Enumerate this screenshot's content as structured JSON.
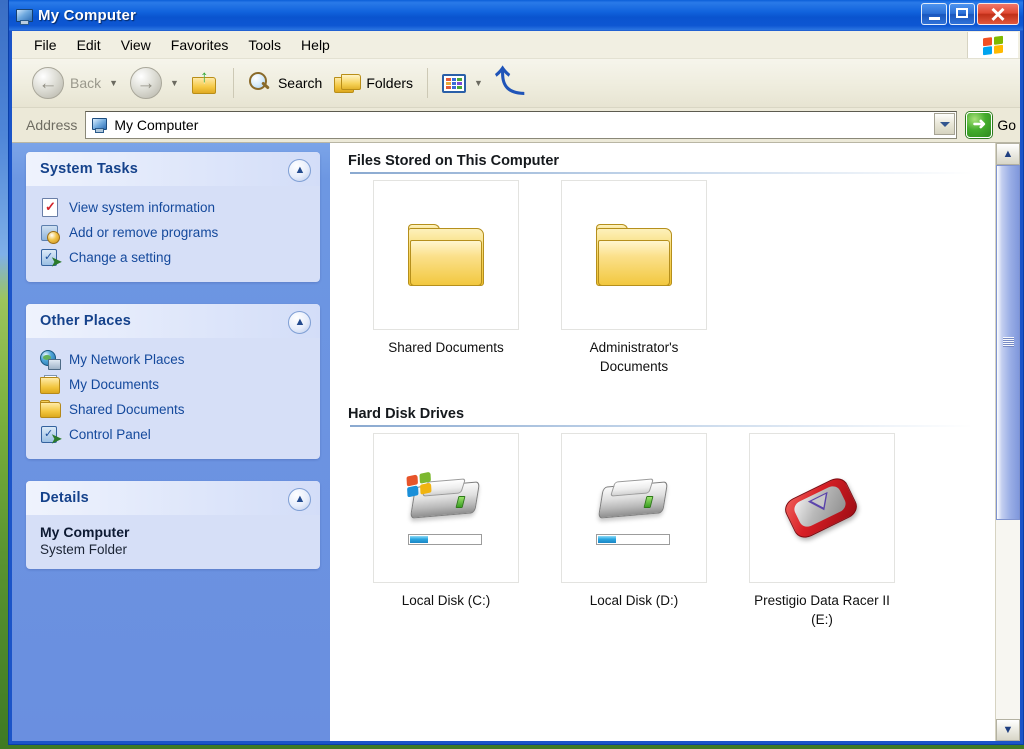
{
  "window": {
    "title": "My Computer",
    "title_icon": "my-computer-icon",
    "controls": {
      "minimize": "minimize-button",
      "maximize": "maximize-button",
      "close": "close-button"
    }
  },
  "menubar": {
    "items": [
      {
        "label": "File"
      },
      {
        "label": "Edit"
      },
      {
        "label": "View"
      },
      {
        "label": "Favorites"
      },
      {
        "label": "Tools"
      },
      {
        "label": "Help"
      }
    ],
    "brand_icon": "windows-flag-icon"
  },
  "toolbar": {
    "back_label": "Back",
    "back_icon": "back-arrow-icon",
    "forward_icon": "forward-arrow-icon",
    "up_icon": "up-folder-icon",
    "search_label": "Search",
    "search_icon": "search-icon",
    "folders_label": "Folders",
    "folders_icon": "folders-icon",
    "views_icon": "views-grid-icon",
    "undo_icon": "undo-arrow-icon"
  },
  "address": {
    "label": "Address",
    "value": "My Computer",
    "icon": "my-computer-icon",
    "dropdown_icon": "chevron-down-icon",
    "go_label": "Go",
    "go_icon": "go-arrow-icon"
  },
  "sidebar": {
    "panels": [
      {
        "title": "System Tasks",
        "collapse_icon": "chevron-up-icon",
        "items": [
          {
            "label": "View system information",
            "icon": "system-information-icon"
          },
          {
            "label": "Add or remove programs",
            "icon": "add-remove-programs-icon"
          },
          {
            "label": "Change a setting",
            "icon": "control-panel-icon"
          }
        ]
      },
      {
        "title": "Other Places",
        "collapse_icon": "chevron-up-icon",
        "items": [
          {
            "label": "My Network Places",
            "icon": "network-places-icon"
          },
          {
            "label": "My Documents",
            "icon": "my-documents-icon"
          },
          {
            "label": "Shared Documents",
            "icon": "shared-folder-icon"
          },
          {
            "label": "Control Panel",
            "icon": "control-panel-icon"
          }
        ]
      },
      {
        "title": "Details",
        "collapse_icon": "chevron-up-icon",
        "detail_name": "My Computer",
        "detail_type": "System Folder"
      }
    ]
  },
  "content": {
    "groups": [
      {
        "heading": "Files Stored on This Computer",
        "items": [
          {
            "label": "Shared Documents",
            "icon": "folder-icon",
            "type": "folder"
          },
          {
            "label": "Administrator's Documents",
            "icon": "folder-icon",
            "type": "folder"
          }
        ]
      },
      {
        "heading": "Hard Disk Drives",
        "items": [
          {
            "label": "Local Disk (C:)",
            "icon": "hard-disk-windows-icon",
            "type": "drive-system",
            "capacity_used_percent": 26
          },
          {
            "label": "Local Disk (D:)",
            "icon": "hard-disk-icon",
            "type": "drive",
            "capacity_used_percent": 26
          },
          {
            "label": "Prestigio Data Racer II (E:)",
            "icon": "external-drive-icon",
            "type": "external-drive"
          }
        ]
      }
    ]
  },
  "scrollbar": {
    "up_icon": "scroll-up-icon",
    "down_icon": "scroll-down-icon",
    "thumb": "scrollbar-thumb"
  },
  "colors": {
    "titlebar_blue": "#1163dd",
    "sidebar_blue": "#6d97e2",
    "panel_body": "#d6dff7",
    "link_blue": "#14499c",
    "heading_blue": "#15428b",
    "close_red": "#c02f18",
    "go_green": "#45ad2e",
    "capacity_blue": "#2aa6e0"
  }
}
